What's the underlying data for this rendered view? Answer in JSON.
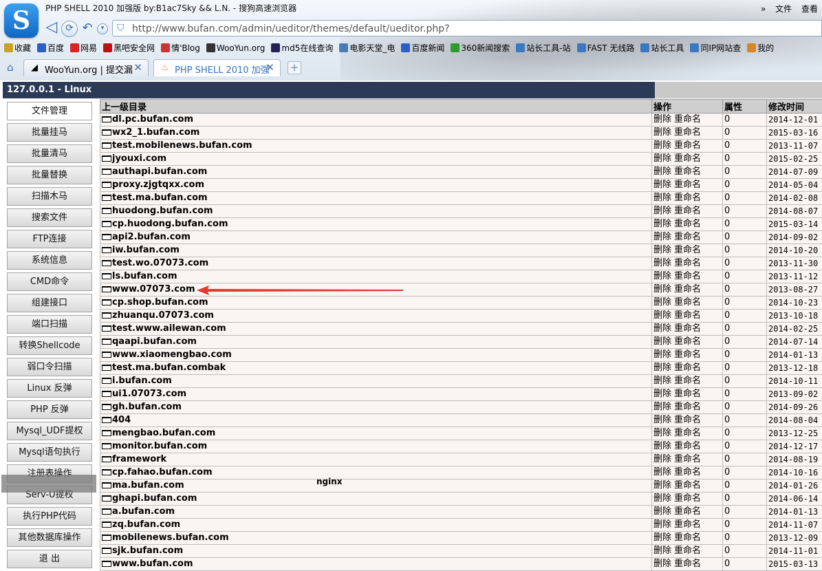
{
  "browser": {
    "window_title": "PHP SHELL 2010 加强版 by:B1ac7Sky && L.N. - 搜狗高速浏览器",
    "menu": {
      "chevron": "»",
      "file": "文件",
      "view": "查看"
    },
    "logo_glyph": "S",
    "address": "http://www.bufan.com/admin/ueditor/themes/default/ueditor.php?",
    "bookmarks": [
      "收藏",
      "百度",
      "网易",
      "黑吧安全网",
      "情'Blog",
      "WooYun.org",
      "md5在线查询",
      "电影天堂_电",
      "百度新闻",
      "360新闻搜索",
      "站长工具-站",
      "FAST 无线路",
      "站长工具",
      "同IP网站查",
      "我的"
    ],
    "bookmark_colors": [
      "#c9a227",
      "#2b5fc7",
      "#d22",
      "#b11",
      "#c33",
      "#333",
      "#225",
      "#4a7db8",
      "#2b5fc7",
      "#2a9d2a",
      "#3a78c2",
      "#3a78c2",
      "#3a78c2",
      "#3a78c2",
      "#d9862b"
    ],
    "tabs": [
      {
        "label": "WooYun.org | 提交漏",
        "active": false
      },
      {
        "label": "PHP SHELL 2010 加强",
        "active": true
      }
    ],
    "new_tab": "+"
  },
  "shell": {
    "host": "127.0.0.1 - Linux",
    "menu": [
      "文件管理",
      "批量挂马",
      "批量清马",
      "批量替换",
      "扫描木马",
      "搜索文件",
      "FTP连接",
      "系统信息",
      "CMD命令",
      "组建接口",
      "端口扫描",
      "转换Shellcode",
      "弱口令扫描",
      "Linux 反弹",
      "PHP 反弹",
      "Mysql_UDF提权",
      "Mysql语句执行",
      "注册表操作",
      "Serv-U提权",
      "执行PHP代码",
      "其他数据库操作",
      "退 出"
    ],
    "active_menu": 0,
    "overlay_text": "nginx"
  },
  "file_table": {
    "headers": {
      "name": "上一级目录",
      "ops": "操作",
      "attr": "属性",
      "mtime": "修改时间"
    },
    "ops": {
      "delete": "删除",
      "rename": "重命名"
    },
    "rows": [
      {
        "name": "dl.pc.bufan.com",
        "attr": "0",
        "mtime": "2014-12-01"
      },
      {
        "name": "wx2_1.bufan.com",
        "attr": "0",
        "mtime": "2015-03-16"
      },
      {
        "name": "test.mobilenews.bufan.com",
        "attr": "0",
        "mtime": "2013-11-07"
      },
      {
        "name": "jyouxi.com",
        "attr": "0",
        "mtime": "2015-02-25"
      },
      {
        "name": "authapi.bufan.com",
        "attr": "0",
        "mtime": "2014-07-09"
      },
      {
        "name": "proxy.zjgtqxx.com",
        "attr": "0",
        "mtime": "2014-05-04"
      },
      {
        "name": "test.ma.bufan.com",
        "attr": "0",
        "mtime": "2014-02-08"
      },
      {
        "name": "huodong.bufan.com",
        "attr": "0",
        "mtime": "2014-08-07"
      },
      {
        "name": "cp.huodong.bufan.com",
        "attr": "0",
        "mtime": "2015-03-14"
      },
      {
        "name": "api2.bufan.com",
        "attr": "0",
        "mtime": "2014-09-02"
      },
      {
        "name": "iw.bufan.com",
        "attr": "0",
        "mtime": "2014-10-20"
      },
      {
        "name": "test.wo.07073.com",
        "attr": "0",
        "mtime": "2013-11-30"
      },
      {
        "name": "ls.bufan.com",
        "attr": "0",
        "mtime": "2013-11-12"
      },
      {
        "name": "www.07073.com",
        "attr": "0",
        "mtime": "2013-08-27"
      },
      {
        "name": "cp.shop.bufan.com",
        "attr": "0",
        "mtime": "2014-10-23"
      },
      {
        "name": "zhuanqu.07073.com",
        "attr": "0",
        "mtime": "2013-10-18"
      },
      {
        "name": "test.www.ailewan.com",
        "attr": "0",
        "mtime": "2014-02-25"
      },
      {
        "name": "qaapi.bufan.com",
        "attr": "0",
        "mtime": "2014-07-14"
      },
      {
        "name": "www.xiaomengbao.com",
        "attr": "0",
        "mtime": "2014-01-13"
      },
      {
        "name": "test.ma.bufan.combak",
        "attr": "0",
        "mtime": "2013-12-18"
      },
      {
        "name": "i.bufan.com",
        "attr": "0",
        "mtime": "2014-10-11"
      },
      {
        "name": "ui1.07073.com",
        "attr": "0",
        "mtime": "2013-09-02"
      },
      {
        "name": "gh.bufan.com",
        "attr": "0",
        "mtime": "2014-09-26"
      },
      {
        "name": "404",
        "attr": "0",
        "mtime": "2014-08-04"
      },
      {
        "name": "mengbao.bufan.com",
        "attr": "0",
        "mtime": "2013-12-25"
      },
      {
        "name": "monitor.bufan.com",
        "attr": "0",
        "mtime": "2014-12-17"
      },
      {
        "name": "framework",
        "attr": "0",
        "mtime": "2014-08-19"
      },
      {
        "name": "cp.fahao.bufan.com",
        "attr": "0",
        "mtime": "2014-10-16"
      },
      {
        "name": "ma.bufan.com",
        "attr": "0",
        "mtime": "2014-01-26"
      },
      {
        "name": "ghapi.bufan.com",
        "attr": "0",
        "mtime": "2014-06-14"
      },
      {
        "name": "a.bufan.com",
        "attr": "0",
        "mtime": "2014-01-13"
      },
      {
        "name": "zq.bufan.com",
        "attr": "0",
        "mtime": "2014-11-07"
      },
      {
        "name": "mobilenews.bufan.com",
        "attr": "0",
        "mtime": "2013-12-09"
      },
      {
        "name": "sjk.bufan.com",
        "attr": "0",
        "mtime": "2014-11-01"
      },
      {
        "name": "www.bufan.com",
        "attr": "0",
        "mtime": "2015-03-13"
      }
    ],
    "highlighted_row": "www.07073.com",
    "arrow_color": "#e23a2e"
  }
}
